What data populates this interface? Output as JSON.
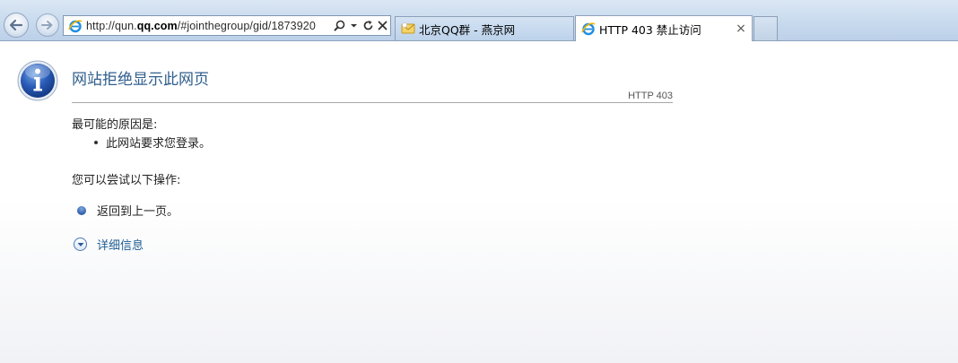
{
  "browser": {
    "address": {
      "url_prefix": "http://qun.",
      "url_domain": "qq.com",
      "url_rest": "/#jointhegroup/gid/1873920"
    },
    "tabs": [
      {
        "label": "北京QQ群 - 燕京网",
        "active": false
      },
      {
        "label": "HTTP 403 禁止访问",
        "active": true
      }
    ]
  },
  "page": {
    "title": "网站拒绝显示此网页",
    "http_code": "HTTP 403",
    "reason_heading": "最可能的原因是:",
    "reasons": [
      "此网站要求您登录。"
    ],
    "action_heading": "您可以尝试以下操作:",
    "back_link": "返回到上一页。",
    "details_link": "详细信息"
  },
  "colors": {
    "title": "#2f5e8c",
    "link": "#1f5e93",
    "chrome": "#c9dbee"
  },
  "icons": {
    "back": "back-arrow-icon",
    "forward": "forward-arrow-icon",
    "search": "search-icon",
    "dropdown": "dropdown-arrow-icon",
    "refresh": "refresh-icon",
    "stop": "close-icon",
    "info": "info-icon"
  }
}
